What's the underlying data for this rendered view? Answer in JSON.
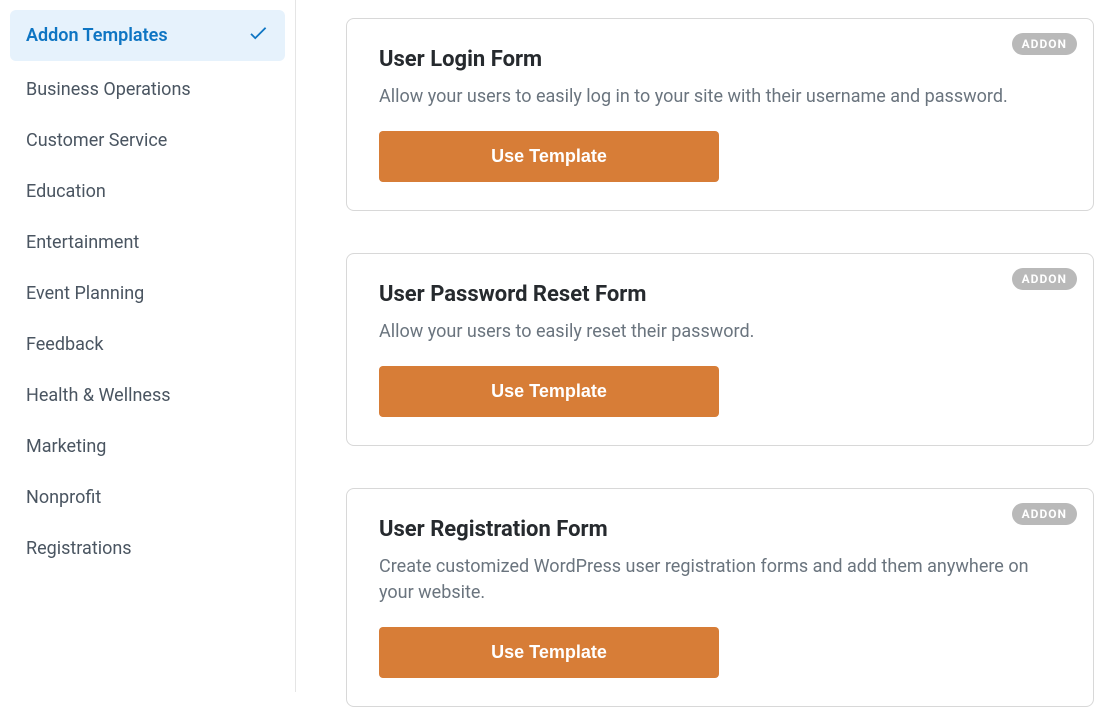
{
  "sidebar": {
    "items": [
      {
        "label": "Addon Templates",
        "active": true
      },
      {
        "label": "Business Operations",
        "active": false
      },
      {
        "label": "Customer Service",
        "active": false
      },
      {
        "label": "Education",
        "active": false
      },
      {
        "label": "Entertainment",
        "active": false
      },
      {
        "label": "Event Planning",
        "active": false
      },
      {
        "label": "Feedback",
        "active": false
      },
      {
        "label": "Health & Wellness",
        "active": false
      },
      {
        "label": "Marketing",
        "active": false
      },
      {
        "label": "Nonprofit",
        "active": false
      },
      {
        "label": "Registrations",
        "active": false
      }
    ]
  },
  "badge_label": "ADDON",
  "templates": [
    {
      "title": "User Login Form",
      "description": "Allow your users to easily log in to your site with their username and password.",
      "button": "Use Template"
    },
    {
      "title": "User Password Reset Form",
      "description": "Allow your users to easily reset their password.",
      "button": "Use Template"
    },
    {
      "title": "User Registration Form",
      "description": "Create customized WordPress user registration forms and add them anywhere on your website.",
      "button": "Use Template"
    }
  ]
}
